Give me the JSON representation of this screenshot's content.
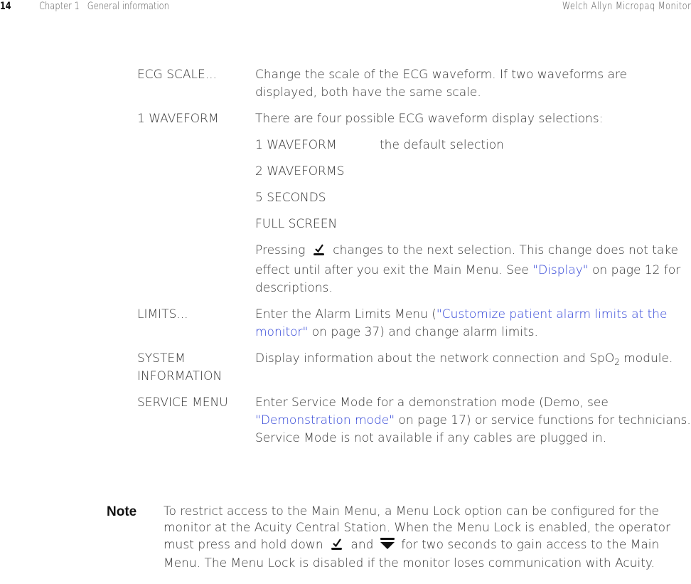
{
  "header": {
    "page_number": "14",
    "chapter": "Chapter 1   General information",
    "product": "Welch Allyn Micropaq Monitor"
  },
  "definitions": [
    {
      "term": "ECG SCALE...",
      "description": "Change the scale of the ECG waveform. If two waveforms are displayed, both have the same scale."
    },
    {
      "term": "1 WAVEFORM",
      "intro": "There are four possible ECG waveform display selections:",
      "options": [
        {
          "label": "1 WAVEFORM",
          "note": "the default selection"
        },
        {
          "label": "2 WAVEFORMS",
          "note": ""
        },
        {
          "label": "5 SECONDS",
          "note": ""
        },
        {
          "label": "FULL SCREEN",
          "note": ""
        }
      ],
      "pressing_before": "Pressing",
      "pressing_icon": "check-key-icon",
      "pressing_after": "changes to the next selection. This change does not take effect until after you exit the Main Menu. See",
      "pressing_link": "\"Display\"",
      "pressing_end": "on page 12 for descriptions."
    },
    {
      "term": "LIMITS...",
      "desc_before": "Enter the Alarm Limits Menu (",
      "desc_link": "\"Customize patient alarm limits at the monitor\"",
      "desc_after": " on page 37) and change alarm limits."
    },
    {
      "term": "SYSTEM INFORMATION",
      "desc_before": "Display information about the network connection and SpO",
      "desc_sub": "2",
      "desc_after": " module."
    },
    {
      "term": "SERVICE MENU",
      "desc_before": "Enter Service Mode for a demonstration mode (Demo, see ",
      "desc_link": "\"Demonstration mode\"",
      "desc_after": " on page 17) or service functions for technicians. Service Mode is not available if any cables are plugged in."
    }
  ],
  "note": {
    "label": "Note",
    "text_before": "To restrict access to the Main Menu, a Menu Lock option can be configured for the monitor at the Acuity Central Station. When the Menu Lock is enabled, the operator must press and hold down",
    "icon1": "check-key-icon",
    "and": "and",
    "icon2": "down-arrow-key-icon",
    "text_after": "for two seconds to gain access to the Main Menu. The Menu Lock is disabled if the monitor loses communication with Acuity."
  },
  "colors": {
    "link": "#2b3fd6",
    "text": "#333333"
  }
}
